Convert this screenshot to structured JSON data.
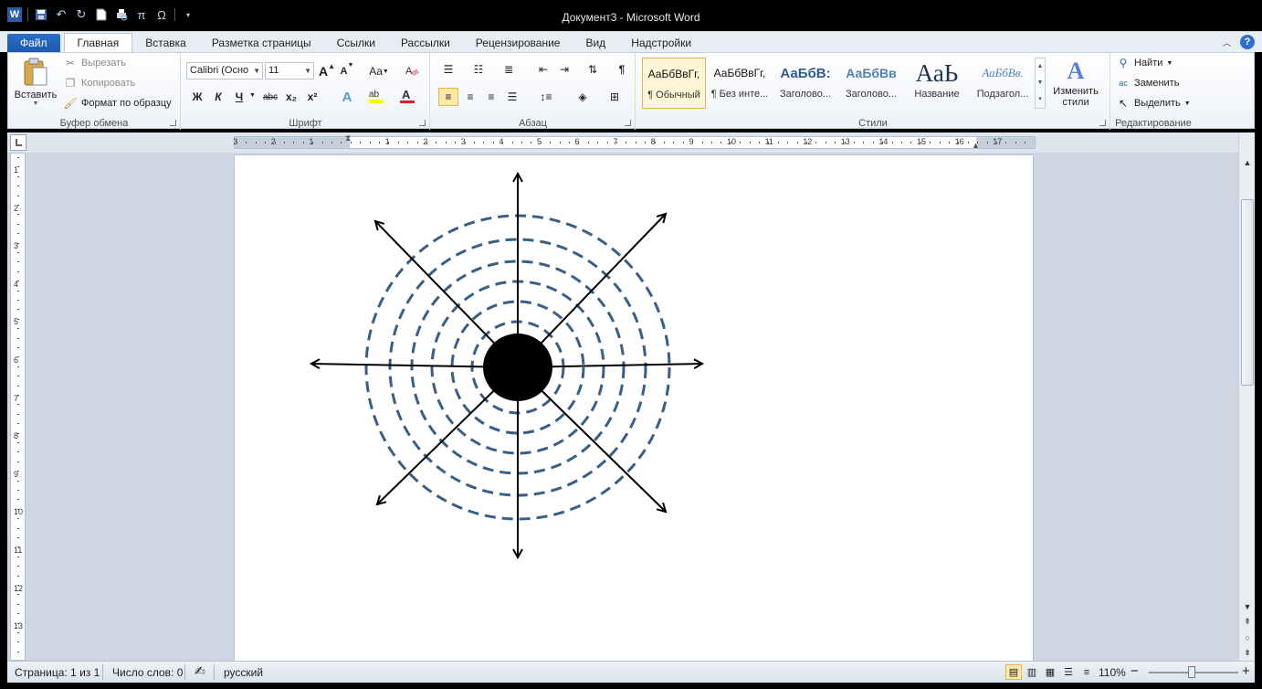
{
  "window": {
    "title": "Документ3 - Microsoft Word"
  },
  "qat": {
    "icons": [
      "word-app-icon",
      "save-icon",
      "undo-icon",
      "redo-icon",
      "new-document-icon",
      "print-preview-icon",
      "pi-equation-icon",
      "omega-symbol-icon",
      "customize-qat-icon"
    ],
    "pi_glyph": "π",
    "omega_glyph": "Ω"
  },
  "tabs": [
    {
      "label": "Файл",
      "kind": "file"
    },
    {
      "label": "Главная",
      "kind": "active"
    },
    {
      "label": "Вставка"
    },
    {
      "label": "Разметка страницы"
    },
    {
      "label": "Ссылки"
    },
    {
      "label": "Рассылки"
    },
    {
      "label": "Рецензирование"
    },
    {
      "label": "Вид"
    },
    {
      "label": "Надстройки"
    }
  ],
  "help_glyph": "?",
  "clipboard": {
    "label": "Буфер обмена",
    "paste": "Вставить",
    "cut": "Вырезать",
    "copy": "Копировать",
    "format_painter": "Формат по образцу"
  },
  "font": {
    "label": "Шрифт",
    "font_name": "Calibri (Осно",
    "font_size": "11",
    "bold": "Ж",
    "italic": "К",
    "underline": "Ч",
    "strike": "abc",
    "subscript": "x₂",
    "superscript": "x²",
    "grow": "A",
    "shrink": "A",
    "change_case": "Aa"
  },
  "paragraph": {
    "label": "Абзац",
    "pilcrow": "¶"
  },
  "styles": {
    "label": "Стили",
    "items": [
      {
        "preview": "АаБбВвГг,",
        "name": "¶ Обычный",
        "selected": true
      },
      {
        "preview": "АаБбВвГг,",
        "name": "¶ Без инте..."
      },
      {
        "preview": "АаБбВ:",
        "name": "Заголово..."
      },
      {
        "preview": "АаБбВв",
        "name": "Заголово..."
      },
      {
        "preview": "АаЬ",
        "name": "Название"
      },
      {
        "preview": "АаБбВв.",
        "name": "Подзагол..."
      }
    ],
    "change_styles_line1": "Изменить",
    "change_styles_line2": "стили"
  },
  "editing": {
    "label": "Редактирование",
    "find": "Найти",
    "replace": "Заменить",
    "select": "Выделить"
  },
  "ruler": {
    "h_labels": [
      "3",
      "2",
      "1",
      "1",
      "2",
      "3",
      "4",
      "5",
      "6",
      "7",
      "8",
      "9",
      "10",
      "11",
      "12",
      "13",
      "14",
      "15",
      "16",
      "17"
    ],
    "v_labels": [
      "1",
      "2",
      "3",
      "4",
      "5",
      "6",
      "7",
      "8",
      "9",
      "10",
      "11",
      "12",
      "13"
    ]
  },
  "status": {
    "page": "Страница: 1 из 1",
    "words": "Число слов: 0",
    "language": "русский",
    "zoom": "110%",
    "zoom_minus": "−",
    "zoom_plus": "+"
  },
  "diagram": {
    "ring_count": 6,
    "arrow_count": 8,
    "colors": {
      "ring": "#3a5f86",
      "arrow": "#000000",
      "center": "#000000"
    }
  }
}
